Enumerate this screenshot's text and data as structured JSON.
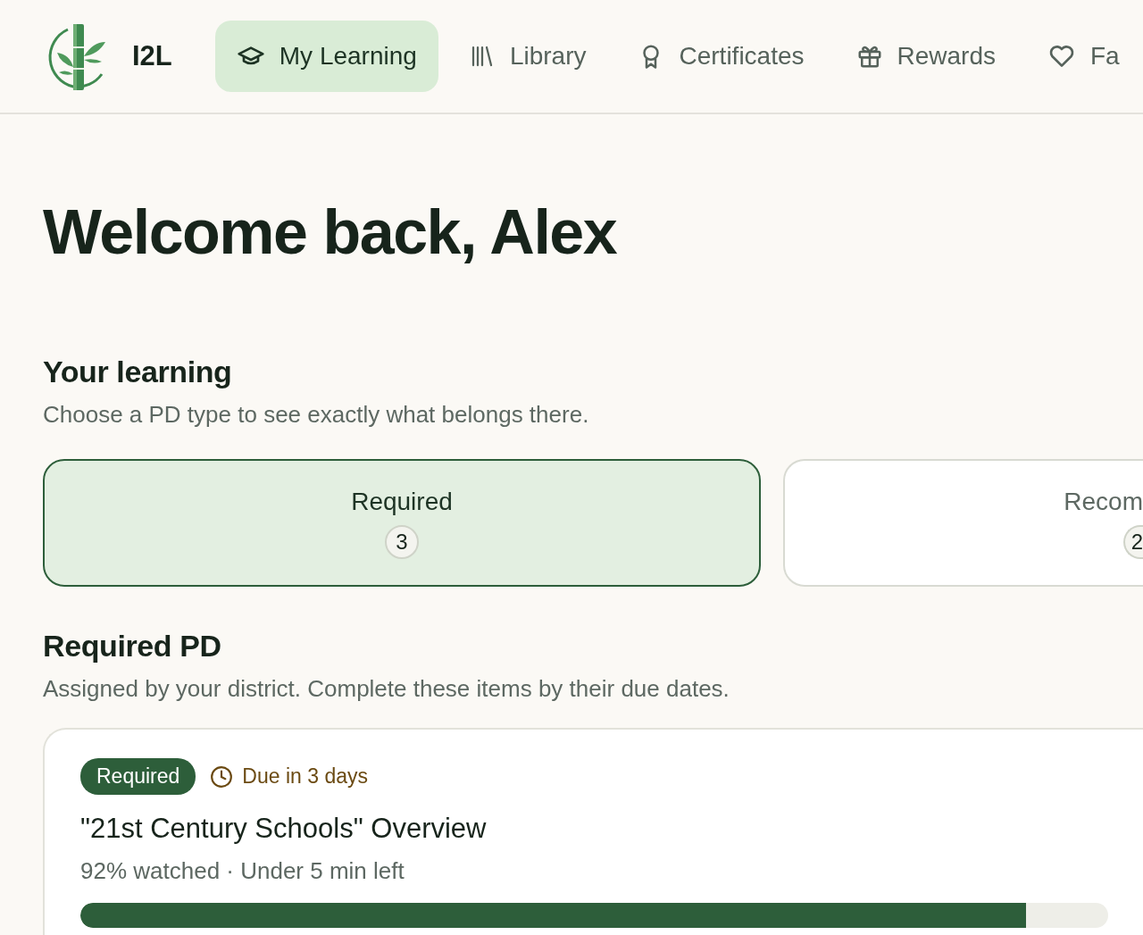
{
  "brand": {
    "name": "I2L"
  },
  "nav": [
    {
      "label": "My Learning",
      "selected": true
    },
    {
      "label": "Library",
      "selected": false
    },
    {
      "label": "Certificates",
      "selected": false
    },
    {
      "label": "Rewards",
      "selected": false
    },
    {
      "label": "Fa",
      "selected": false
    }
  ],
  "welcome": "Welcome back, Alex",
  "your_learning": {
    "title": "Your learning",
    "subtitle": "Choose a PD type to see exactly what belongs there.",
    "types": [
      {
        "label": "Required",
        "count": "3",
        "selected": true
      },
      {
        "label": "Recom",
        "count": "2",
        "selected": false
      }
    ]
  },
  "section": {
    "title": "Required PD",
    "subtitle": "Assigned by your district. Complete these items by their due dates.",
    "items": [
      {
        "badge": "Required",
        "due": "Due in 3 days",
        "title": "\"21st Century Schools\" Overview",
        "meta": "92% watched · Under 5 min left",
        "level": 0.92
      }
    ]
  }
}
